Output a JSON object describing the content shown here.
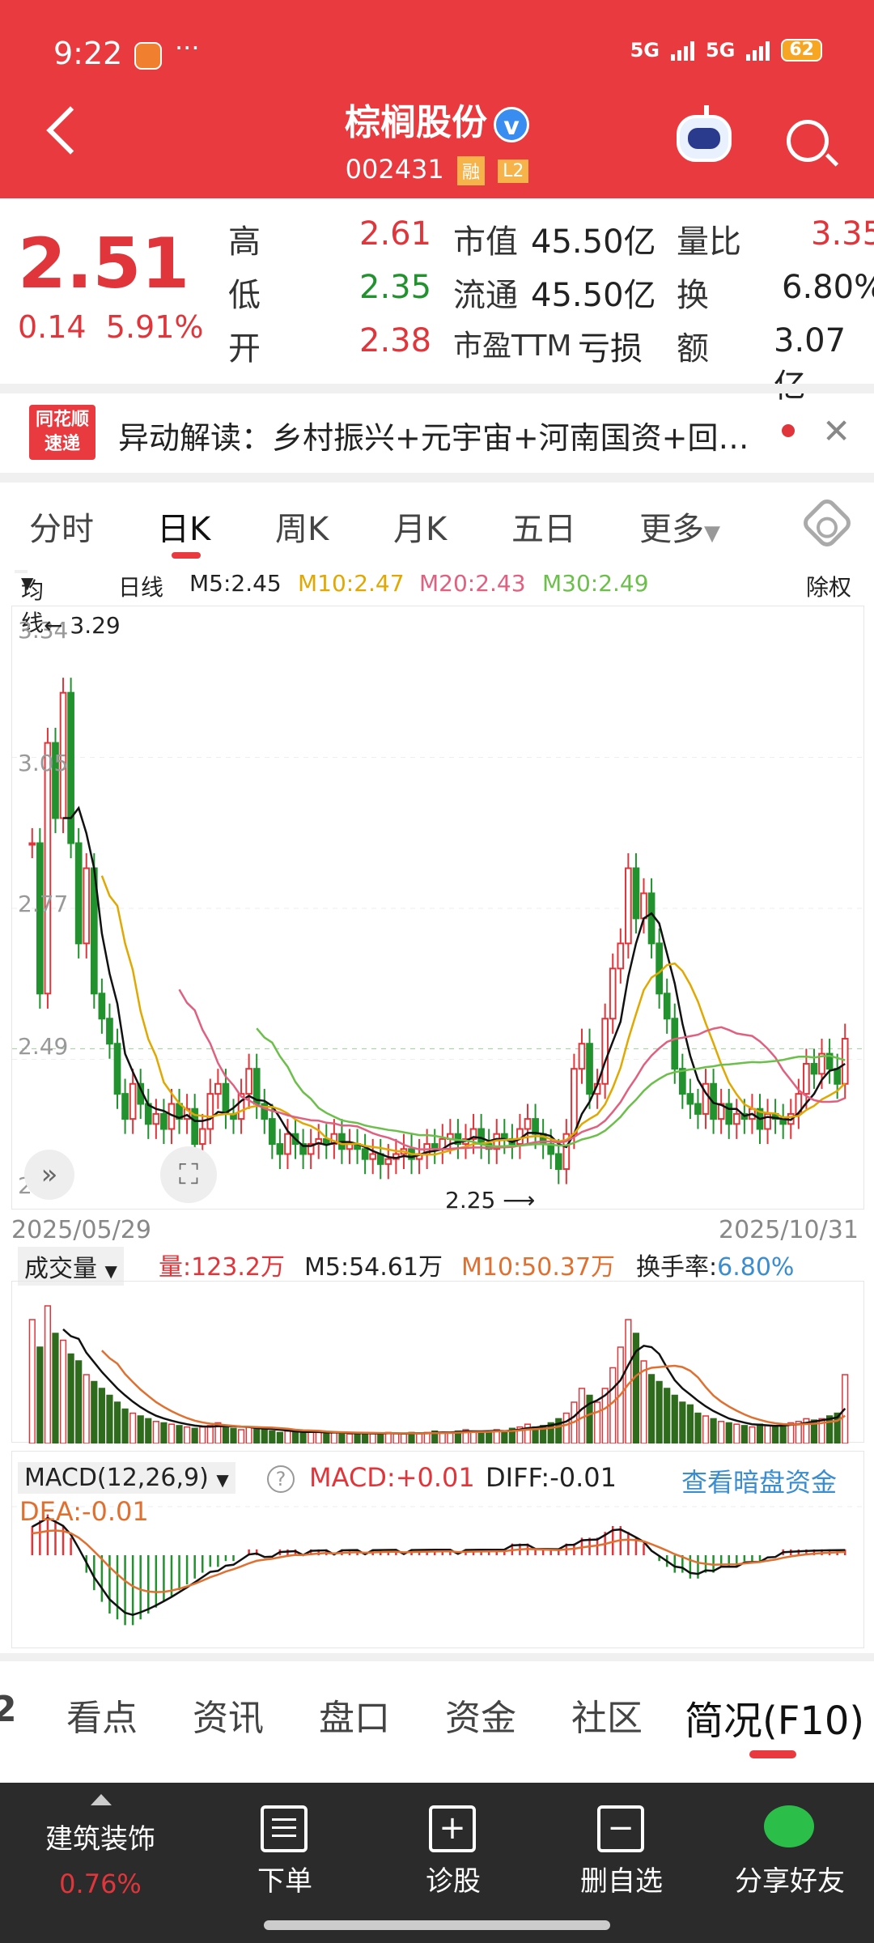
{
  "status": {
    "time": "9:22",
    "dots": "···",
    "net1": "5G",
    "net2": "5G",
    "battery": "62"
  },
  "header": {
    "name": "棕榈股份",
    "verified": "v",
    "code": "002431",
    "tag1": "融",
    "tag2": "L2"
  },
  "quote": {
    "price": "2.51",
    "change": "0.14",
    "change_pct": "5.91%",
    "high_label": "高",
    "high": "2.61",
    "low_label": "低",
    "low": "2.35",
    "open_label": "开",
    "open": "2.38",
    "mcap_label": "市值",
    "mcap": "45.50亿",
    "float_label": "流通",
    "float": "45.50亿",
    "pe_label": "市盈TTM",
    "pe": "亏损",
    "vr_label": "量比",
    "vr": "3.35",
    "turnover_label": "换",
    "turnover": "6.80%",
    "amount_label": "额",
    "amount": "3.07亿"
  },
  "news": {
    "logo_line1": "同花顺",
    "logo_line2": "速递",
    "text": "异动解读：乡村振兴+元宇宙+河南国资+回…"
  },
  "chart_tabs": [
    "分时",
    "日K",
    "周K",
    "月K",
    "五日",
    "更多"
  ],
  "ma": {
    "selector": "均线",
    "period": "日线",
    "m5": "M5:2.45",
    "m10": "M10:2.47",
    "m20": "M20:2.43",
    "m30": "M30:2.49",
    "adjust": "除权",
    "c_m5": "#111111",
    "c_m10": "#e0a800",
    "c_m20": "#e06080",
    "c_m30": "#6cbf4a"
  },
  "axis": {
    "y": [
      "3.34",
      "3.05",
      "2.77",
      "2.49",
      "2.20"
    ],
    "hi_mark": "3.29",
    "lo_mark": "2.25",
    "date_start": "2025/05/29",
    "date_end": "2025/10/31"
  },
  "volume": {
    "selector": "成交量",
    "vol": "量:123.2万",
    "m5": "M5:54.61万",
    "m10": "M10:50.37万",
    "turnover_label": "换手率:",
    "turnover": "6.80%"
  },
  "macd": {
    "selector": "MACD(12,26,9)",
    "help": "?",
    "macd": "MACD:+0.01",
    "diff": "DIFF:-0.01",
    "dea": "DEA:-0.01",
    "link": "查看暗盘资金"
  },
  "bottom_tabs": [
    "2",
    "看点",
    "资讯",
    "盘口",
    "资金",
    "社区",
    "简况(F10)"
  ],
  "bottom_bar": {
    "sector": "建筑装饰",
    "sector_pct": "0.76%",
    "items": [
      "下单",
      "诊股",
      "删自选",
      "分享好友"
    ]
  },
  "chart_data": {
    "type": "candlestick",
    "x": [
      "2025/05/29",
      "2025/10/31"
    ],
    "ylim": [
      2.2,
      3.34
    ],
    "close": [
      2.9,
      2.6,
      3.1,
      2.95,
      3.2,
      2.9,
      2.7,
      2.85,
      2.6,
      2.55,
      2.5,
      2.4,
      2.35,
      2.42,
      2.38,
      2.34,
      2.36,
      2.33,
      2.38,
      2.35,
      2.37,
      2.3,
      2.33,
      2.4,
      2.42,
      2.36,
      2.35,
      2.4,
      2.45,
      2.38,
      2.35,
      2.3,
      2.28,
      2.32,
      2.3,
      2.28,
      2.3,
      2.31,
      2.3,
      2.32,
      2.29,
      2.3,
      2.29,
      2.27,
      2.28,
      2.26,
      2.27,
      2.28,
      2.29,
      2.27,
      2.28,
      2.3,
      2.29,
      2.31,
      2.32,
      2.3,
      2.31,
      2.33,
      2.3,
      2.29,
      2.32,
      2.31,
      2.3,
      2.33,
      2.35,
      2.32,
      2.3,
      2.28,
      2.25,
      2.32,
      2.45,
      2.5,
      2.4,
      2.42,
      2.55,
      2.65,
      2.7,
      2.85,
      2.75,
      2.8,
      2.7,
      2.6,
      2.55,
      2.45,
      2.4,
      2.38,
      2.36,
      2.42,
      2.35,
      2.38,
      2.34,
      2.36,
      2.35,
      2.37,
      2.33,
      2.36,
      2.35,
      2.34,
      2.36,
      2.4,
      2.46,
      2.44,
      2.48,
      2.45,
      2.42,
      2.51
    ],
    "volume": [
      90,
      70,
      100,
      80,
      75,
      65,
      60,
      50,
      45,
      40,
      35,
      30,
      25,
      22,
      20,
      18,
      16,
      15,
      14,
      13,
      12,
      11,
      12,
      13,
      15,
      12,
      11,
      10,
      12,
      11,
      10,
      9,
      8,
      9,
      8,
      8,
      9,
      8,
      7,
      8,
      8,
      7,
      7,
      8,
      7,
      7,
      8,
      7,
      7,
      8,
      7,
      8,
      9,
      8,
      8,
      9,
      10,
      9,
      8,
      9,
      10,
      9,
      11,
      12,
      14,
      12,
      13,
      15,
      18,
      22,
      30,
      40,
      35,
      30,
      40,
      55,
      70,
      90,
      80,
      60,
      50,
      45,
      40,
      35,
      30,
      28,
      22,
      20,
      18,
      16,
      15,
      14,
      13,
      12,
      14,
      13,
      12,
      14,
      15,
      16,
      18,
      17,
      18,
      20,
      22,
      50
    ],
    "macd": [
      0.05,
      0.06,
      0.07,
      0.06,
      0.05,
      0.03,
      0.0,
      -0.03,
      -0.06,
      -0.08,
      -0.1,
      -0.11,
      -0.12,
      -0.12,
      -0.11,
      -0.1,
      -0.09,
      -0.08,
      -0.07,
      -0.06,
      -0.05,
      -0.04,
      -0.03,
      -0.02,
      -0.02,
      -0.01,
      -0.01,
      0.0,
      0.01,
      0.01,
      0.0,
      0.0,
      0.01,
      0.01,
      0.01,
      0.0,
      0.01,
      0.01,
      0.01,
      0.0,
      0.01,
      0.01,
      0.01,
      0.0,
      0.01,
      0.01,
      0.01,
      0.01,
      0.0,
      0.01,
      0.01,
      0.01,
      0.01,
      0.01,
      0.01,
      0.0,
      0.01,
      0.01,
      0.01,
      0.01,
      0.01,
      0.01,
      0.02,
      0.02,
      0.02,
      0.01,
      0.01,
      0.01,
      0.01,
      0.02,
      0.02,
      0.03,
      0.03,
      0.03,
      0.04,
      0.05,
      0.05,
      0.04,
      0.03,
      0.02,
      0.0,
      -0.01,
      -0.02,
      -0.03,
      -0.03,
      -0.04,
      -0.04,
      -0.03,
      -0.03,
      -0.02,
      -0.02,
      -0.02,
      -0.01,
      -0.01,
      -0.01,
      0.0,
      0.0,
      0.01,
      0.01,
      0.01,
      0.01,
      0.01,
      0.01,
      0.01,
      0.01,
      0.01
    ]
  }
}
